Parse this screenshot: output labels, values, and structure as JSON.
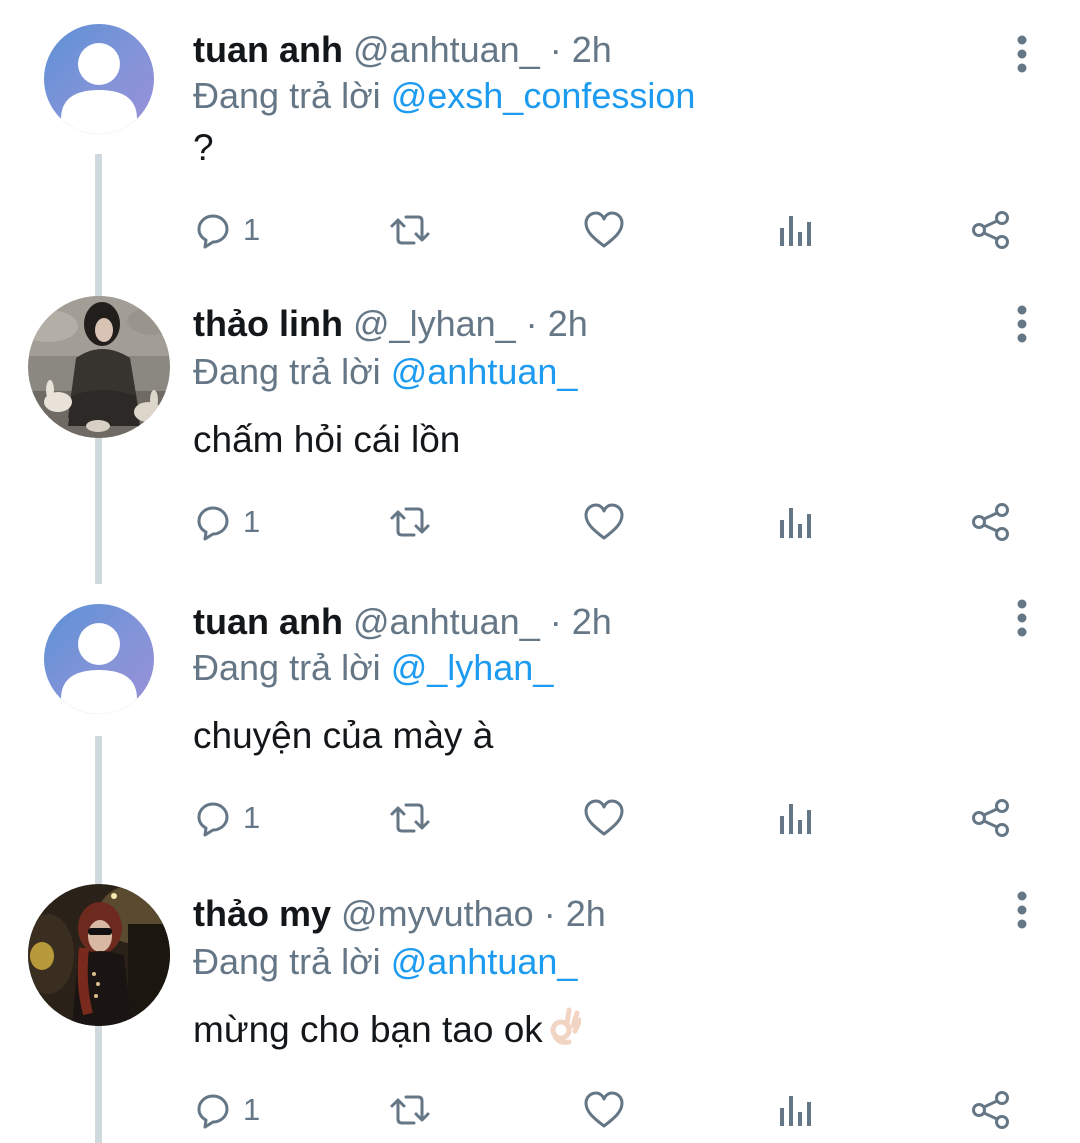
{
  "tweets": [
    {
      "name": "tuan anh",
      "handle": "@anhtuan_",
      "dot": "·",
      "time": "2h",
      "reply_prefix": "Đang trả lời",
      "reply_to": "@exsh_confession",
      "text": "?",
      "reply_count": "1",
      "avatar": "default-user-icon"
    },
    {
      "name": "thảo linh",
      "handle": "@_lyhan_",
      "dot": "·",
      "time": "2h",
      "reply_prefix": "Đang trả lời",
      "reply_to": "@anhtuan_",
      "text": "chấm hỏi cái lồn",
      "reply_count": "1",
      "avatar": "photo"
    },
    {
      "name": "tuan anh",
      "handle": "@anhtuan_",
      "dot": "·",
      "time": "2h",
      "reply_prefix": "Đang trả lời",
      "reply_to": "@_lyhan_",
      "text": "chuyện của mày à",
      "reply_count": "1",
      "avatar": "default-user-icon"
    },
    {
      "name": "thảo my",
      "handle": "@myvuthao",
      "dot": "·",
      "time": "2h",
      "reply_prefix": "Đang trả lời",
      "reply_to": "@anhtuan_",
      "text": "mừng cho bạn tao ok",
      "reply_count": "1",
      "avatar": "photo"
    }
  ],
  "icons": {
    "reply": "comment-icon",
    "retweet": "retweet-icon",
    "like": "heart-icon",
    "analytics": "analytics-icon",
    "share": "share-icon",
    "more": "more-vertical-icon",
    "emoji": "ok-hand-emoji-icon"
  },
  "colors": {
    "link": "#1d9bf0",
    "secondary_text": "#657786",
    "thread_line": "#cfd9de"
  }
}
